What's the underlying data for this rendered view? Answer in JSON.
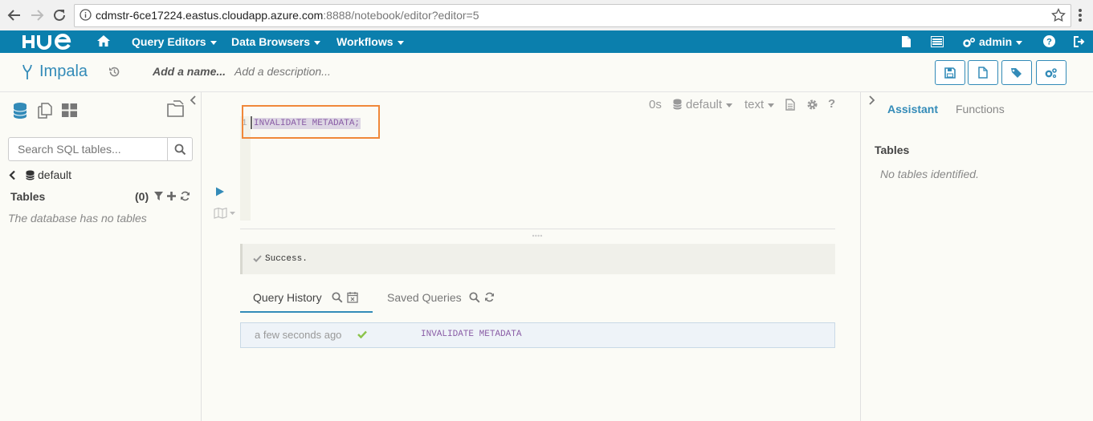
{
  "browser": {
    "url_host": "cdmstr-6ce17224.eastus.cloudapp.azure.com",
    "url_path": ":8888/notebook/editor?editor=5"
  },
  "nav": {
    "logo": "HUE",
    "items": [
      {
        "label": "Query Editors"
      },
      {
        "label": "Data Browsers"
      },
      {
        "label": "Workflows"
      }
    ],
    "user": "admin"
  },
  "editor": {
    "title": "Impala",
    "name_placeholder": "Add a name...",
    "description_placeholder": "Add a description...",
    "elapsed": "0s",
    "database": "default",
    "format": "text",
    "line_number": "1",
    "query": "INVALIDATE METADATA;",
    "result_message": "Success."
  },
  "left": {
    "search_placeholder": "Search SQL tables...",
    "database": "default",
    "tables_label": "Tables",
    "tables_count": "(0)",
    "empty_message": "The database has no tables"
  },
  "history": {
    "tabs": [
      {
        "label": "Query History"
      },
      {
        "label": "Saved Queries"
      }
    ],
    "rows": [
      {
        "time": "a few seconds ago",
        "query": "INVALIDATE METADATA"
      }
    ]
  },
  "assistant": {
    "tabs": [
      {
        "label": "Assistant"
      },
      {
        "label": "Functions"
      }
    ],
    "tables_label": "Tables",
    "empty_message": "No tables identified."
  },
  "colors": {
    "brand": "#0B7FAD",
    "link": "#338BB8",
    "highlight_box": "#F0883A",
    "success": "#8BC34A",
    "query_text": "#8A5DA6"
  }
}
